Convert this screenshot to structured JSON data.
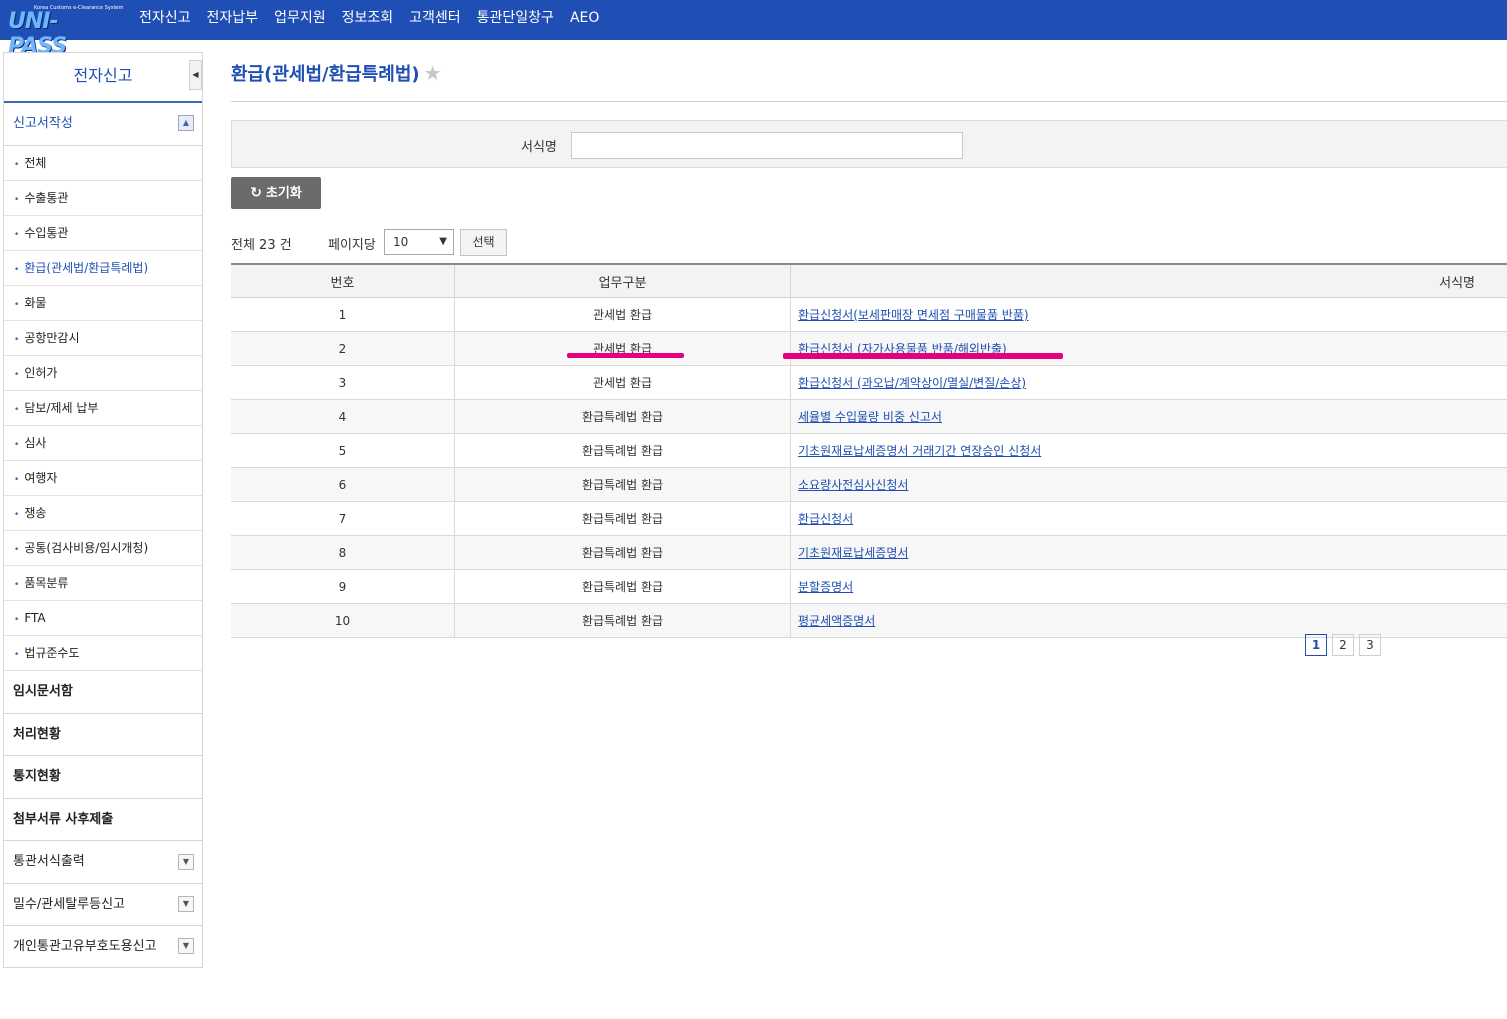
{
  "header": {
    "logo_sub": "Korea Customs e-Clearance System",
    "logo_main": "UNI-PASS",
    "nav": [
      "전자신고",
      "전자납부",
      "업무지원",
      "정보조회",
      "고객센터",
      "통관단일창구",
      "AEO"
    ]
  },
  "sidebar": {
    "title": "전자신고",
    "section": "신고서작성",
    "sub_items": [
      "전체",
      "수출통관",
      "수입통관",
      "환급(관세법/환급특례법)",
      "화물",
      "공항만감시",
      "인허가",
      "담보/제세 납부",
      "심사",
      "여행자",
      "쟁송",
      "공통(검사비용/임시개청)",
      "품목분류",
      "FTA",
      "법규준수도"
    ],
    "main_items": [
      "임시문서함",
      "처리현황",
      "통지현황",
      "첨부서류 사후제출"
    ],
    "collapsible_items": [
      "통관서식출력",
      "밀수/관세탈루등신고",
      "개인통관고유부호도용신고"
    ]
  },
  "page": {
    "title": "환급(관세법/환급특례법)"
  },
  "search": {
    "label": "서식명",
    "value": ""
  },
  "toolbar": {
    "reset_label": "초기화",
    "total_text": "전체 23 건",
    "per_page_label": "페이지당",
    "per_page_value": "10",
    "select_label": "선택"
  },
  "table": {
    "headers": [
      "번호",
      "업무구분",
      "서식명"
    ],
    "rows": [
      {
        "no": "1",
        "category": "관세법 환급",
        "form": "환급신청서(보세판매장 면세점 구매물품 반품)"
      },
      {
        "no": "2",
        "category": "관세법 환급",
        "form": "환급신청서 (자가사용물품 반품/해외반출)"
      },
      {
        "no": "3",
        "category": "관세법 환급",
        "form": "환급신청서 (과오납/계약상이/멸실/변질/손상)"
      },
      {
        "no": "4",
        "category": "환급특례법 환급",
        "form": "세율별 수입물량 비중 신고서"
      },
      {
        "no": "5",
        "category": "환급특례법 환급",
        "form": "기초원재료납세증명서 거래기간 연장승인 신청서"
      },
      {
        "no": "6",
        "category": "환급특례법 환급",
        "form": "소요량사전심사신청서"
      },
      {
        "no": "7",
        "category": "환급특례법 환급",
        "form": "환급신청서"
      },
      {
        "no": "8",
        "category": "환급특례법 환급",
        "form": "기초원재료납세증명서"
      },
      {
        "no": "9",
        "category": "환급특례법 환급",
        "form": "분할증명서"
      },
      {
        "no": "10",
        "category": "환급특례법 환급",
        "form": "평균세액증명서"
      }
    ]
  },
  "pagination": {
    "pages": [
      "1",
      "2",
      "3"
    ],
    "current": "1"
  },
  "colors": {
    "header_bg": "#1f4fb4",
    "accent": "#1f4fb4",
    "highlight": "#e6007e"
  }
}
